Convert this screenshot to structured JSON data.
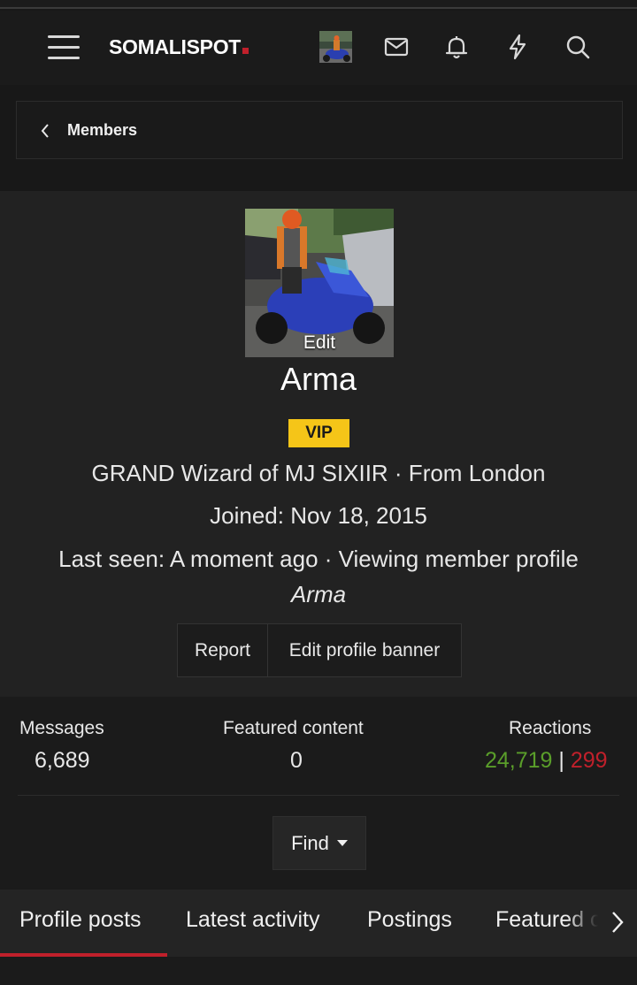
{
  "colors": {
    "accent_red": "#c0202b",
    "badge_yellow": "#f5c518",
    "reaction_positive": "#5a9e2a",
    "reaction_negative": "#c0202b"
  },
  "header": {
    "logo": "SOMALISPOT",
    "icons": [
      "menu-icon",
      "envelope-icon",
      "bell-icon",
      "lightning-icon",
      "search-icon"
    ]
  },
  "breadcrumb": {
    "label": "Members"
  },
  "profile": {
    "avatar_edit": "Edit",
    "username": "Arma",
    "badge": "VIP",
    "line1": "GRAND Wizard of MJ SIXIIR · From London",
    "joined": "Joined: Nov 18, 2015",
    "last_seen": "Last seen: A moment ago · Viewing member profile",
    "last_seen_user": "Arma",
    "actions": {
      "report": "Report",
      "edit_banner": "Edit profile banner"
    }
  },
  "stats": {
    "messages_label": "Messages",
    "messages_value": "6,689",
    "featured_label": "Featured content",
    "featured_value": "0",
    "reactions_label": "Reactions",
    "reactions_positive": "24,719",
    "reactions_sep": "|",
    "reactions_negative": "299",
    "find": "Find"
  },
  "tabs": [
    "Profile posts",
    "Latest activity",
    "Postings",
    "Featured content"
  ]
}
